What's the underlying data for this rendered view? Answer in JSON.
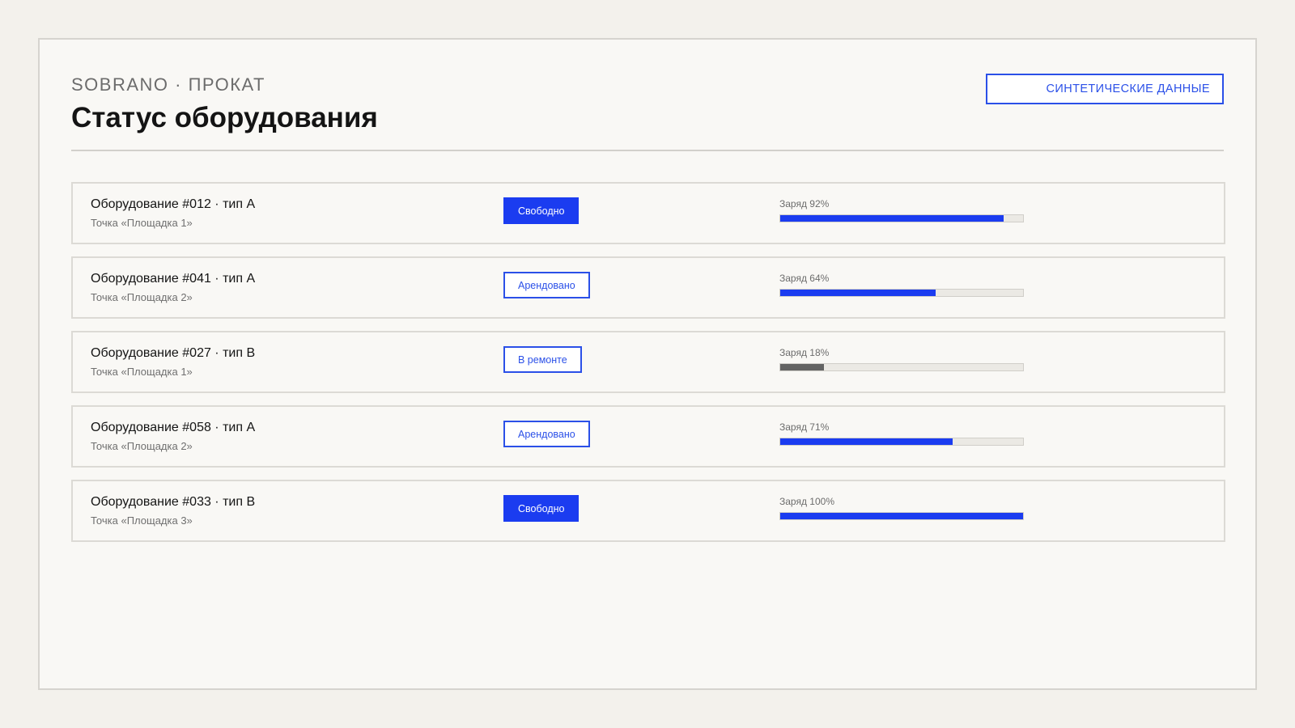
{
  "header": {
    "brand": "SOBRANO · ПРОКАТ",
    "title": "Статус оборудования",
    "badge": "СИНТЕТИЧЕСКИЕ ДАННЫЕ"
  },
  "colors": {
    "accent": "#1b3cf0",
    "low_charge": "#636363"
  },
  "equipment": [
    {
      "name": "Оборудование #012 · тип A",
      "location": "Точка «Площадка 1»",
      "status": "Свободно",
      "status_style": "filled",
      "charge_label": "Заряд 92%",
      "charge_percent": 92
    },
    {
      "name": "Оборудование #041 · тип A",
      "location": "Точка «Площадка 2»",
      "status": "Арендовано",
      "status_style": "outline",
      "charge_label": "Заряд 64%",
      "charge_percent": 64
    },
    {
      "name": "Оборудование #027 · тип B",
      "location": "Точка «Площадка 1»",
      "status": "В ремонте",
      "status_style": "outline",
      "charge_label": "Заряд 18%",
      "charge_percent": 18
    },
    {
      "name": "Оборудование #058 · тип A",
      "location": "Точка «Площадка 2»",
      "status": "Арендовано",
      "status_style": "outline",
      "charge_label": "Заряд 71%",
      "charge_percent": 71
    },
    {
      "name": "Оборудование #033 · тип B",
      "location": "Точка «Площадка 3»",
      "status": "Свободно",
      "status_style": "filled",
      "charge_label": "Заряд 100%",
      "charge_percent": 100
    }
  ]
}
